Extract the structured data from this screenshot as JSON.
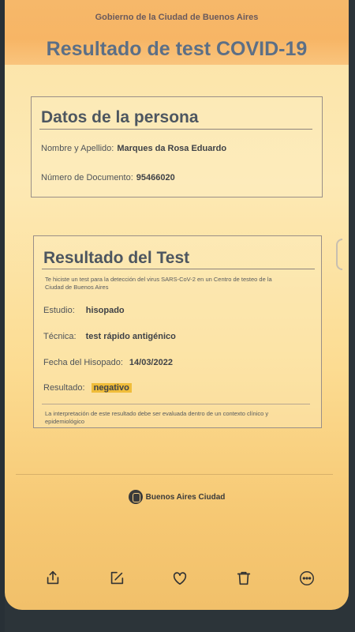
{
  "header": {
    "government": "Gobierno de la Ciudad de Buenos Aires",
    "title": "Resultado de test COVID-19"
  },
  "person": {
    "section_title": "Datos de la persona",
    "name_label": "Nombre y Apellido:",
    "name_value": "Marques da Rosa Eduardo",
    "doc_label": "Número de Documento:",
    "doc_value": "95466020"
  },
  "result": {
    "section_title": "Resultado del Test",
    "intro": "Te hiciste un test para la detección del virus SARS-CoV-2 en un Centro de testeo de la Ciudad de Buenos Aires",
    "study_label": "Estudio:",
    "study_value": "hisopado",
    "technique_label": "Técnica:",
    "technique_value": "test rápido antigénico",
    "date_label": "Fecha del Hisopado:",
    "date_value": "14/03/2022",
    "result_label": "Resultado:",
    "result_value": "negativo",
    "footnote": "La interpretación de este resultado debe ser evaluada dentro de un contexto clínico y epidemiológico"
  },
  "footer": {
    "logo_text": "Buenos Aires Ciudad"
  },
  "toolbar": {
    "icons": [
      "share-icon",
      "edit-icon",
      "heart-icon",
      "trash-icon",
      "more-icon"
    ]
  },
  "colors": {
    "title": "#5c6f86",
    "highlight": "#f0bd3a",
    "background": "#fde9b4"
  }
}
